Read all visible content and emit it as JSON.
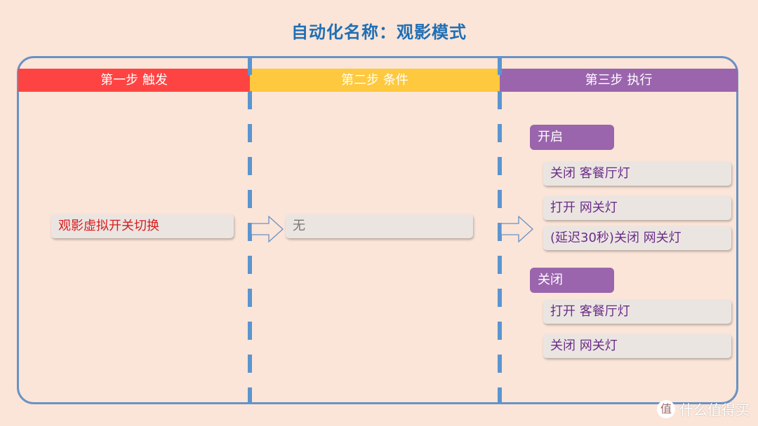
{
  "title": "自动化名称：观影模式",
  "steps": [
    {
      "label": "第一步 触发",
      "color": "#fe4443"
    },
    {
      "label": "第二步 条件",
      "color": "#fec93e"
    },
    {
      "label": "第三步 执行",
      "color": "#9a65ad"
    }
  ],
  "trigger": {
    "text": "观影虚拟开关切换"
  },
  "condition": {
    "text": "无"
  },
  "actions": {
    "on": {
      "label": "开启",
      "items": [
        "关闭 客餐厅灯",
        "打开 网关灯",
        "(延迟30秒)关闭 网关灯"
      ]
    },
    "off": {
      "label": "关闭",
      "items": [
        "打开 客餐厅灯",
        "关闭 网关灯"
      ]
    }
  },
  "watermark": {
    "logo": "值",
    "text": "什么值得买"
  }
}
